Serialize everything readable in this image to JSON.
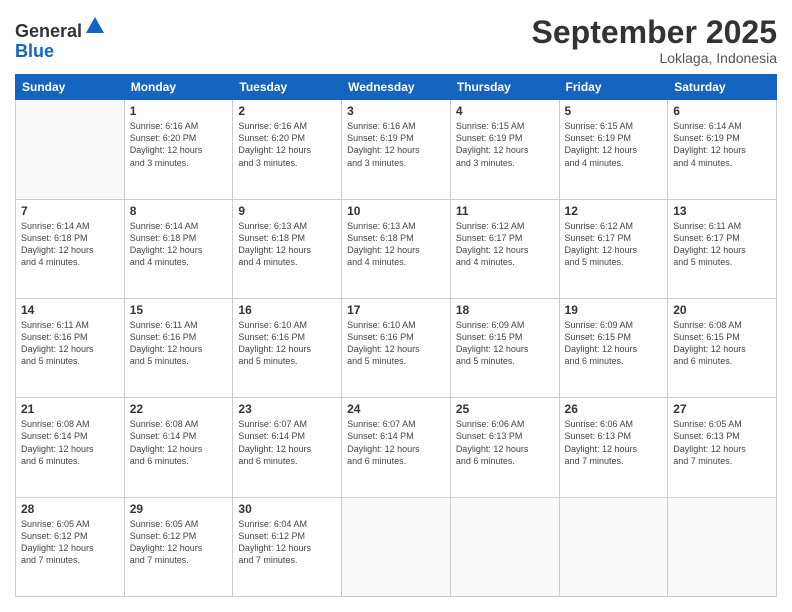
{
  "logo": {
    "line1": "General",
    "line2": "Blue"
  },
  "title": "September 2025",
  "location": "Loklaga, Indonesia",
  "days_of_week": [
    "Sunday",
    "Monday",
    "Tuesday",
    "Wednesday",
    "Thursday",
    "Friday",
    "Saturday"
  ],
  "weeks": [
    [
      {
        "day": "",
        "info": ""
      },
      {
        "day": "1",
        "info": "Sunrise: 6:16 AM\nSunset: 6:20 PM\nDaylight: 12 hours\nand 3 minutes."
      },
      {
        "day": "2",
        "info": "Sunrise: 6:16 AM\nSunset: 6:20 PM\nDaylight: 12 hours\nand 3 minutes."
      },
      {
        "day": "3",
        "info": "Sunrise: 6:16 AM\nSunset: 6:19 PM\nDaylight: 12 hours\nand 3 minutes."
      },
      {
        "day": "4",
        "info": "Sunrise: 6:15 AM\nSunset: 6:19 PM\nDaylight: 12 hours\nand 3 minutes."
      },
      {
        "day": "5",
        "info": "Sunrise: 6:15 AM\nSunset: 6:19 PM\nDaylight: 12 hours\nand 4 minutes."
      },
      {
        "day": "6",
        "info": "Sunrise: 6:14 AM\nSunset: 6:19 PM\nDaylight: 12 hours\nand 4 minutes."
      }
    ],
    [
      {
        "day": "7",
        "info": "Sunrise: 6:14 AM\nSunset: 6:18 PM\nDaylight: 12 hours\nand 4 minutes."
      },
      {
        "day": "8",
        "info": "Sunrise: 6:14 AM\nSunset: 6:18 PM\nDaylight: 12 hours\nand 4 minutes."
      },
      {
        "day": "9",
        "info": "Sunrise: 6:13 AM\nSunset: 6:18 PM\nDaylight: 12 hours\nand 4 minutes."
      },
      {
        "day": "10",
        "info": "Sunrise: 6:13 AM\nSunset: 6:18 PM\nDaylight: 12 hours\nand 4 minutes."
      },
      {
        "day": "11",
        "info": "Sunrise: 6:12 AM\nSunset: 6:17 PM\nDaylight: 12 hours\nand 4 minutes."
      },
      {
        "day": "12",
        "info": "Sunrise: 6:12 AM\nSunset: 6:17 PM\nDaylight: 12 hours\nand 5 minutes."
      },
      {
        "day": "13",
        "info": "Sunrise: 6:11 AM\nSunset: 6:17 PM\nDaylight: 12 hours\nand 5 minutes."
      }
    ],
    [
      {
        "day": "14",
        "info": "Sunrise: 6:11 AM\nSunset: 6:16 PM\nDaylight: 12 hours\nand 5 minutes."
      },
      {
        "day": "15",
        "info": "Sunrise: 6:11 AM\nSunset: 6:16 PM\nDaylight: 12 hours\nand 5 minutes."
      },
      {
        "day": "16",
        "info": "Sunrise: 6:10 AM\nSunset: 6:16 PM\nDaylight: 12 hours\nand 5 minutes."
      },
      {
        "day": "17",
        "info": "Sunrise: 6:10 AM\nSunset: 6:16 PM\nDaylight: 12 hours\nand 5 minutes."
      },
      {
        "day": "18",
        "info": "Sunrise: 6:09 AM\nSunset: 6:15 PM\nDaylight: 12 hours\nand 5 minutes."
      },
      {
        "day": "19",
        "info": "Sunrise: 6:09 AM\nSunset: 6:15 PM\nDaylight: 12 hours\nand 6 minutes."
      },
      {
        "day": "20",
        "info": "Sunrise: 6:08 AM\nSunset: 6:15 PM\nDaylight: 12 hours\nand 6 minutes."
      }
    ],
    [
      {
        "day": "21",
        "info": "Sunrise: 6:08 AM\nSunset: 6:14 PM\nDaylight: 12 hours\nand 6 minutes."
      },
      {
        "day": "22",
        "info": "Sunrise: 6:08 AM\nSunset: 6:14 PM\nDaylight: 12 hours\nand 6 minutes."
      },
      {
        "day": "23",
        "info": "Sunrise: 6:07 AM\nSunset: 6:14 PM\nDaylight: 12 hours\nand 6 minutes."
      },
      {
        "day": "24",
        "info": "Sunrise: 6:07 AM\nSunset: 6:14 PM\nDaylight: 12 hours\nand 6 minutes."
      },
      {
        "day": "25",
        "info": "Sunrise: 6:06 AM\nSunset: 6:13 PM\nDaylight: 12 hours\nand 6 minutes."
      },
      {
        "day": "26",
        "info": "Sunrise: 6:06 AM\nSunset: 6:13 PM\nDaylight: 12 hours\nand 7 minutes."
      },
      {
        "day": "27",
        "info": "Sunrise: 6:05 AM\nSunset: 6:13 PM\nDaylight: 12 hours\nand 7 minutes."
      }
    ],
    [
      {
        "day": "28",
        "info": "Sunrise: 6:05 AM\nSunset: 6:12 PM\nDaylight: 12 hours\nand 7 minutes."
      },
      {
        "day": "29",
        "info": "Sunrise: 6:05 AM\nSunset: 6:12 PM\nDaylight: 12 hours\nand 7 minutes."
      },
      {
        "day": "30",
        "info": "Sunrise: 6:04 AM\nSunset: 6:12 PM\nDaylight: 12 hours\nand 7 minutes."
      },
      {
        "day": "",
        "info": ""
      },
      {
        "day": "",
        "info": ""
      },
      {
        "day": "",
        "info": ""
      },
      {
        "day": "",
        "info": ""
      }
    ]
  ]
}
